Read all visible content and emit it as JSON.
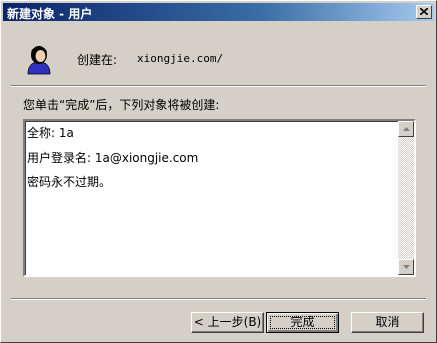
{
  "window": {
    "title": "新建对象 - 用户",
    "close_icon": "close-icon"
  },
  "header": {
    "icon": "user-icon",
    "create_in_label": "创建在:",
    "create_in_value": "xiongjie.com/"
  },
  "instruction": "您单击“完成”后，下列对象将被创建:",
  "summary": {
    "lines": [
      "全称: 1a",
      "用户登录名: 1a@xiongjie.com",
      "密码永不过期。"
    ]
  },
  "buttons": {
    "back": "< 上一步(B)",
    "finish": "完成",
    "cancel": "取消"
  },
  "colors": {
    "title_bar_start": "#0a246a",
    "title_bar_end": "#a6caf0",
    "dialog_bg": "#d4d0c8"
  }
}
